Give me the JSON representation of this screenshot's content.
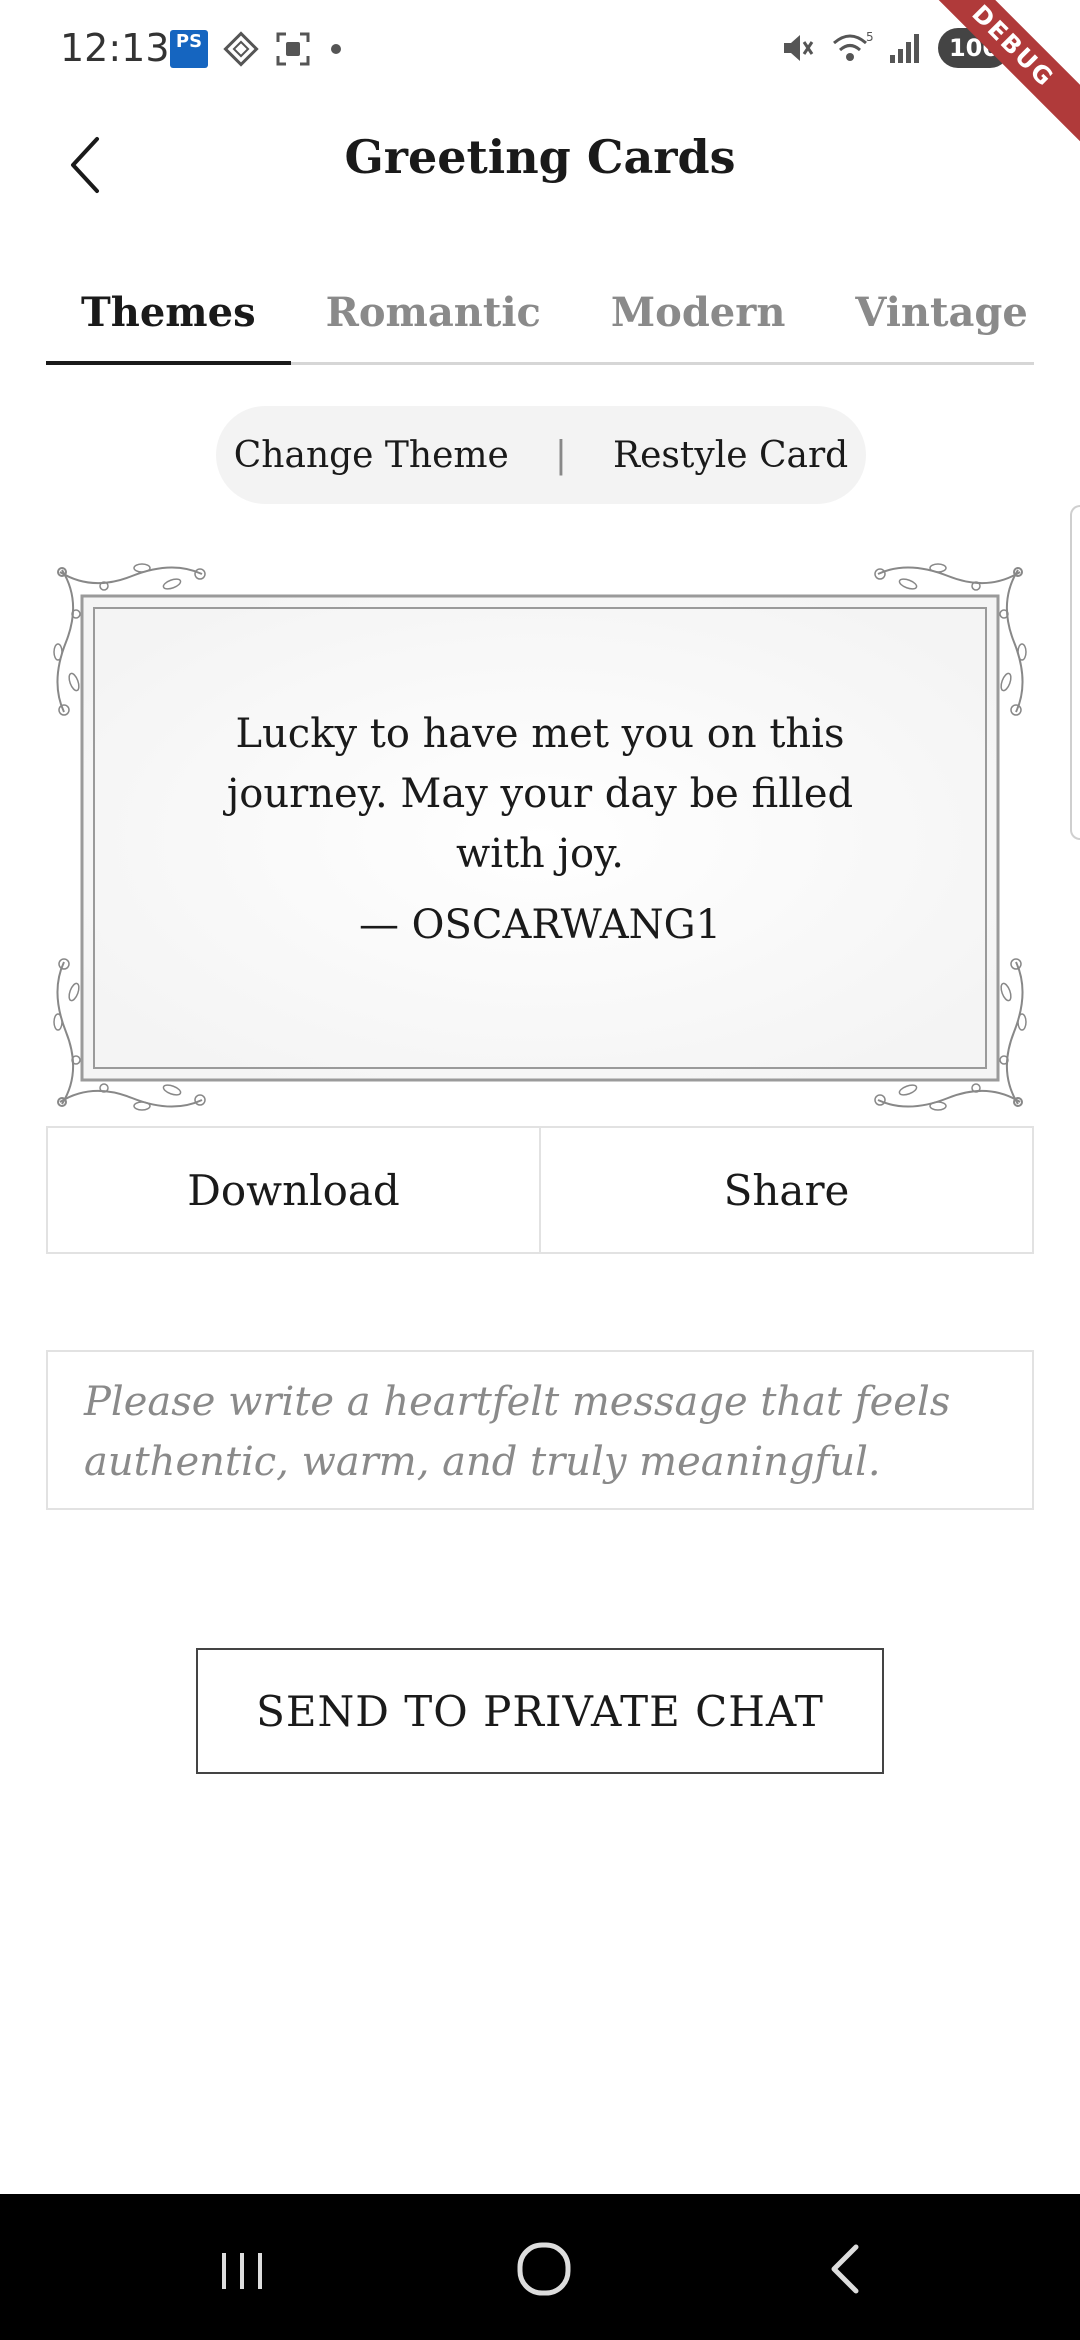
{
  "status_bar": {
    "time": "12:13",
    "ps_badge": "PS",
    "battery": "100",
    "debug_banner": "DEBUG",
    "left_icons": [
      "ps-express-icon",
      "diamond-app-icon",
      "screenshot-icon",
      "dot-icon"
    ],
    "right_icons": [
      "mute-icon",
      "wifi-icon",
      "signal-icon",
      "battery-icon"
    ]
  },
  "header": {
    "title": "Greeting Cards",
    "back_icon": "chevron-left-icon"
  },
  "tabs": [
    {
      "label": "Themes",
      "active": true
    },
    {
      "label": "Romantic",
      "active": false
    },
    {
      "label": "Modern",
      "active": false
    },
    {
      "label": "Vintage",
      "active": false
    }
  ],
  "toolbar": {
    "change_theme": "Change Theme",
    "separator": "|",
    "restyle_card": "Restyle Card"
  },
  "card": {
    "message": "Lucky to have met you on this journey. May your day be filled with joy.",
    "signature": "— OSCARWANG1"
  },
  "actions": {
    "download": "Download",
    "share": "Share"
  },
  "message_box": {
    "placeholder": "Please write a heartfelt message that feels authentic, warm, and truly meaningful."
  },
  "send_button": "SEND TO PRIVATE CHAT",
  "nav_bar": {
    "recents_icon": "recents-icon",
    "home_icon": "home-icon",
    "back_icon": "back-icon"
  },
  "colors": {
    "text": "#1a1a1a",
    "muted": "#8a8a8a",
    "border": "#e2e2e2",
    "pill_bg": "#f3f3f3",
    "debug": "#b03a3a",
    "nav_bg": "#000000"
  }
}
